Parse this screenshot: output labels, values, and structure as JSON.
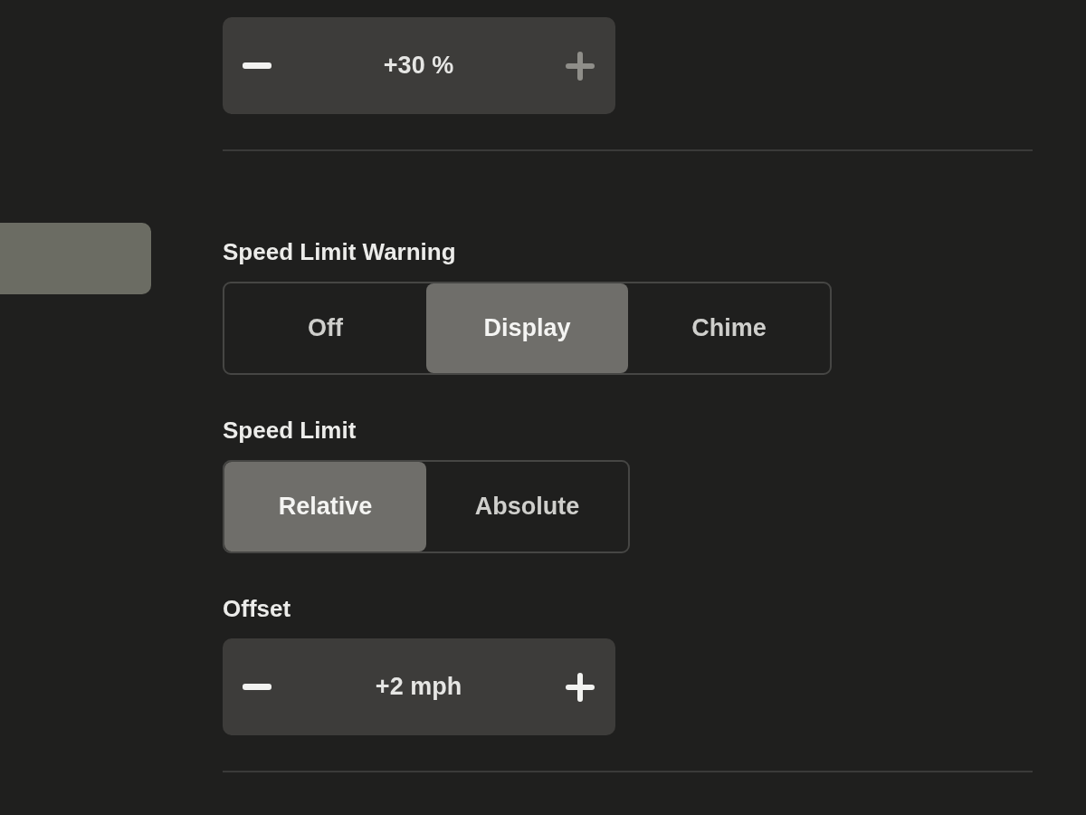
{
  "sidebar": {
    "items": [
      {
        "selected": true
      }
    ]
  },
  "groups": [
    {
      "settings": [
        {
          "kind": "stepper",
          "value": "+30 %",
          "decrease_disabled": false,
          "increase_disabled": true
        }
      ]
    },
    {
      "settings": [
        {
          "kind": "segmented",
          "label": "Speed Limit Warning",
          "options": [
            {
              "label": "Off",
              "selected": false
            },
            {
              "label": "Display",
              "selected": true
            },
            {
              "label": "Chime",
              "selected": false
            }
          ]
        },
        {
          "kind": "segmented",
          "label": "Speed Limit",
          "options": [
            {
              "label": "Relative",
              "selected": true
            },
            {
              "label": "Absolute",
              "selected": false
            }
          ]
        },
        {
          "kind": "stepper",
          "label": "Offset",
          "value": "+2 mph",
          "decrease_disabled": false,
          "increase_disabled": false
        }
      ]
    }
  ]
}
